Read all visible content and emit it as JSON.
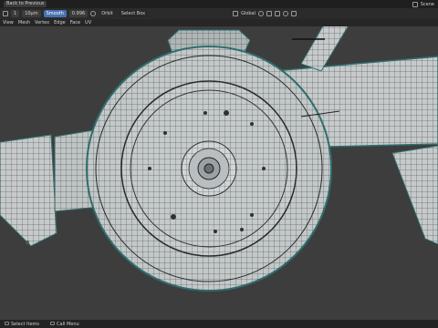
{
  "titlebar": {
    "back_label": "Back to Previous",
    "workspace": "Scene"
  },
  "toolbar": {
    "zoom_value": "1",
    "units_value": "10μm",
    "mode_label": "Smooth",
    "strength_value": "0.996",
    "orient_label": "Orbit",
    "select_label": "Select Box",
    "transform_label": "Global"
  },
  "header": {
    "menu": [
      "View",
      "Mesh",
      "Vertex",
      "Edge",
      "Face",
      "UV"
    ]
  },
  "status": {
    "left": "Select Items",
    "middle": "Call Menu"
  },
  "colors": {
    "viewport": "#3d3d3d",
    "mesh_fill": "#c8cccd",
    "wire": "#202020",
    "edge_highlight": "#2f6f6f",
    "accent": "#4772b3"
  }
}
